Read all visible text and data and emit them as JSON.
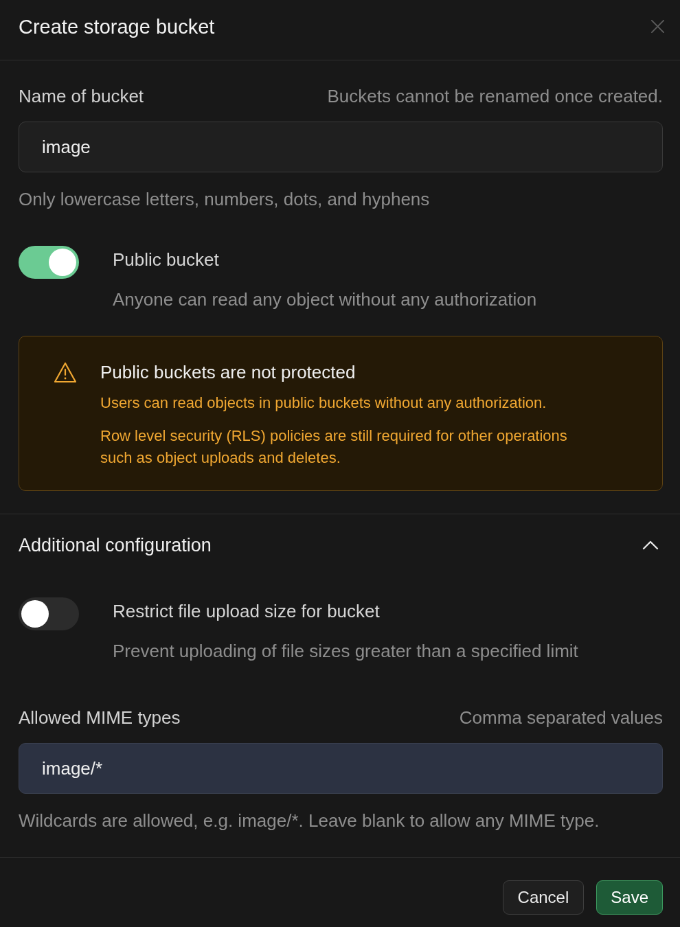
{
  "dialog": {
    "title": "Create storage bucket"
  },
  "name_field": {
    "label": "Name of bucket",
    "hint": "Buckets cannot be renamed once created.",
    "value": "image",
    "help": "Only lowercase letters, numbers, dots, and hyphens"
  },
  "public_toggle": {
    "label": "Public bucket",
    "description": "Anyone can read any object without any authorization",
    "on": true
  },
  "warning": {
    "title": "Public buckets are not protected",
    "paragraphs": [
      "Users can read objects in public buckets without any authorization.",
      "Row level security (RLS) policies are still required for other operations such as object uploads and deletes."
    ]
  },
  "additional_configuration": {
    "title": "Additional configuration",
    "expanded": true,
    "size_toggle": {
      "label": "Restrict file upload size for bucket",
      "description": "Prevent uploading of file sizes greater than a specified limit",
      "on": false
    },
    "mime_field": {
      "label": "Allowed MIME types",
      "hint": "Comma separated values",
      "value": "image/*",
      "help": "Wildcards are allowed, e.g. image/*. Leave blank to allow any MIME type."
    }
  },
  "buttons": [
    {
      "label": "Cancel",
      "kind": "secondary"
    },
    {
      "label": "Save",
      "kind": "primary"
    }
  ]
}
